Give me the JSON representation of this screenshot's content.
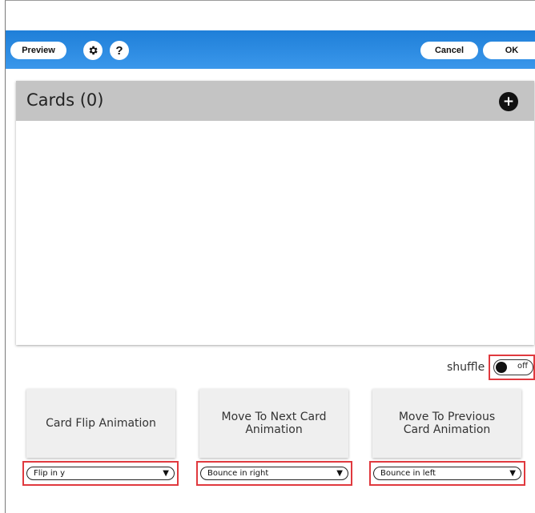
{
  "toolbar": {
    "preview_label": "Preview",
    "help_label": "?",
    "cancel_label": "Cancel",
    "ok_label": "OK"
  },
  "cards": {
    "title": "Cards (0)",
    "add_label": "+"
  },
  "shuffle": {
    "label": "shuffle",
    "state": "off"
  },
  "animations": [
    {
      "title": "Card Flip Animation",
      "selected": "Flip in y"
    },
    {
      "title": "Move To Next Card Animation",
      "selected": "Bounce in right"
    },
    {
      "title": "Move To Previous Card Animation",
      "selected": "Bounce in left"
    }
  ],
  "colors": {
    "toolbar_top": "#1f7fd8",
    "toolbar_bottom": "#3a97eb",
    "highlight_border": "#e0393e",
    "header_gray": "#c4c4c4"
  }
}
